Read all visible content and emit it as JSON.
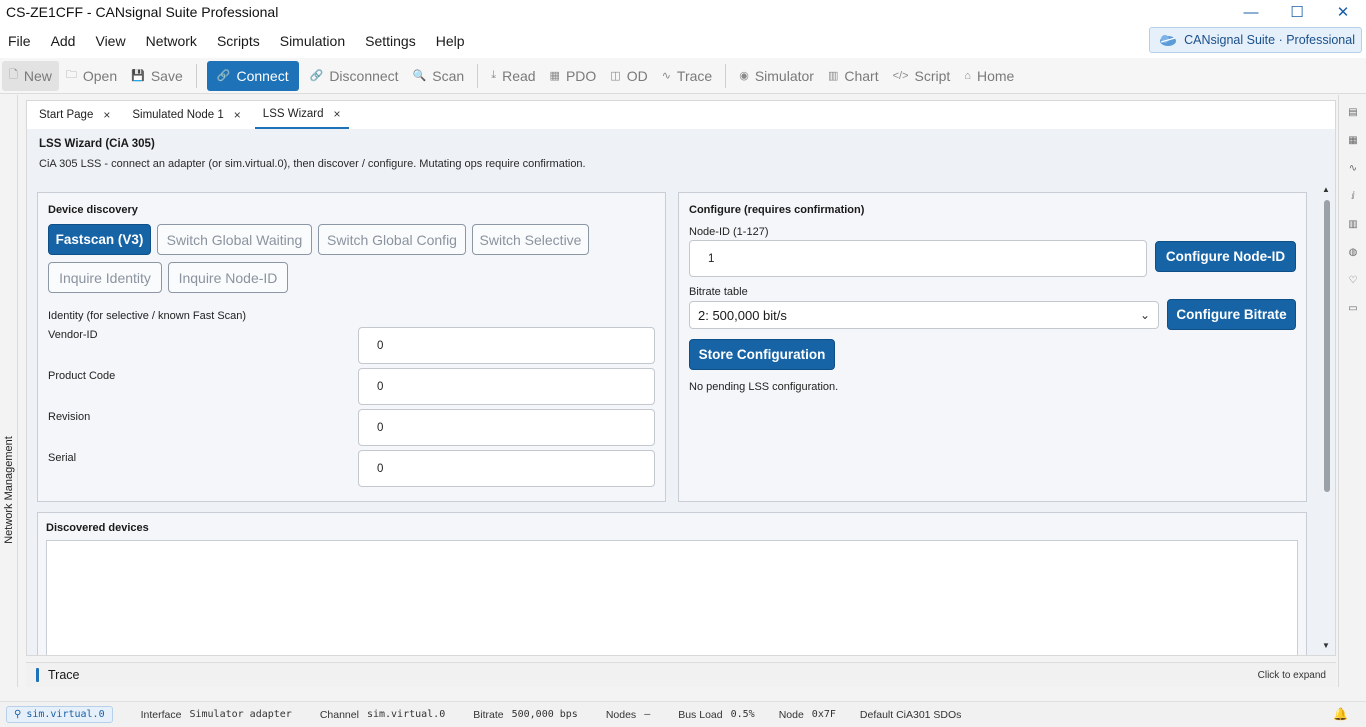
{
  "window": {
    "title": "CS-ZE1CFF - CANsignal Suite Professional",
    "minimize": "—",
    "maximize": "☐",
    "close": "✕"
  },
  "menu": [
    "File",
    "Add",
    "View",
    "Network",
    "Scripts",
    "Simulation",
    "Settings",
    "Help"
  ],
  "brand": {
    "label": "CANsignal Suite · Professional",
    "icon": "cloud-logo-icon"
  },
  "toolbar": [
    {
      "label": "New",
      "icon": "new-file-icon",
      "glyph": "🗋"
    },
    {
      "label": "Open",
      "icon": "folder-icon",
      "glyph": "🗀"
    },
    {
      "label": "Save",
      "icon": "save-icon",
      "glyph": "💾"
    },
    {
      "label": "Connect",
      "icon": "plug-icon",
      "glyph": "🔗"
    },
    {
      "label": "Disconnect",
      "icon": "unplug-icon",
      "glyph": "🔗"
    },
    {
      "label": "Scan",
      "icon": "search-icon",
      "glyph": "🔍"
    },
    {
      "label": "Read",
      "icon": "download-icon",
      "glyph": "⤓"
    },
    {
      "label": "PDO",
      "icon": "grid-icon",
      "glyph": "▦"
    },
    {
      "label": "OD",
      "icon": "book-icon",
      "glyph": "◫"
    },
    {
      "label": "Trace",
      "icon": "pulse-icon",
      "glyph": "∿"
    },
    {
      "label": "Simulator",
      "icon": "play-circle-icon",
      "glyph": "◉"
    },
    {
      "label": "Chart",
      "icon": "chart-icon",
      "glyph": "▥"
    },
    {
      "label": "Script",
      "icon": "code-icon",
      "glyph": "</>"
    },
    {
      "label": "Home",
      "icon": "home-icon",
      "glyph": "⌂"
    }
  ],
  "left_dock": {
    "label": "Network Management"
  },
  "tabs": [
    {
      "label": "Start Page",
      "close": "×"
    },
    {
      "label": "Simulated Node 1",
      "close": "×"
    },
    {
      "label": "LSS Wizard",
      "close": "×"
    }
  ],
  "page": {
    "title": "LSS Wizard (CiA 305)",
    "subtitle": "CiA 305 LSS - connect an adapter (or sim.virtual.0), then discover / configure. Mutating ops require confirmation."
  },
  "discovery": {
    "title": "Device discovery",
    "buttons": {
      "fastscan": "Fastscan (V3)",
      "switch_global_waiting": "Switch Global Waiting",
      "switch_global_config": "Switch Global Config",
      "switch_selective": "Switch Selective",
      "inquire_identity": "Inquire Identity",
      "inquire_node_id": "Inquire Node-ID"
    },
    "identity_label": "Identity (for selective / known Fast Scan)",
    "fields": {
      "vendor_label": "Vendor-ID",
      "vendor_value": "0",
      "product_label": "Product Code",
      "product_value": "0",
      "revision_label": "Revision",
      "revision_value": "0",
      "serial_label": "Serial",
      "serial_value": "0"
    }
  },
  "configure": {
    "title": "Configure (requires confirmation)",
    "node_id_label": "Node-ID (1-127)",
    "node_id_value": "1",
    "configure_node_id": "Configure Node-ID",
    "bitrate_label": "Bitrate table",
    "bitrate_value": "2: 500,000 bit/s",
    "configure_bitrate": "Configure Bitrate",
    "store": "Store Configuration",
    "status": "No pending LSS configuration."
  },
  "discovered": {
    "title": "Discovered devices"
  },
  "trace": {
    "title": "Trace",
    "expand": "Click to expand"
  },
  "status": {
    "chip": "sim.virtual.0",
    "interface_k": "Interface",
    "interface_v": "Simulator adapter",
    "channel_k": "Channel",
    "channel_v": "sim.virtual.0",
    "bitrate_k": "Bitrate",
    "bitrate_v": "500,000 bps",
    "nodes_k": "Nodes",
    "nodes_v": "–",
    "busload_k": "Bus Load",
    "busload_v": "0.5%",
    "node_k": "Node",
    "node_v": "0x7F",
    "sdo": "Default CiA301 SDOs"
  },
  "colors": {
    "accent": "#1d72b8",
    "primary_button": "#1663a6",
    "panel_bg": "#f4f6f9"
  }
}
